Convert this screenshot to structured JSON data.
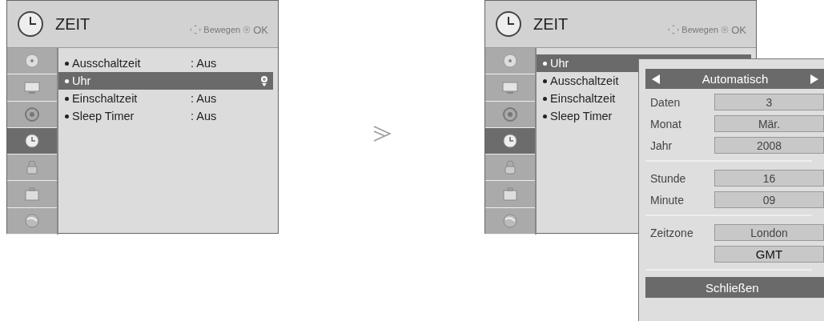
{
  "screens": [
    {
      "title": "ZEIT",
      "hint_move": "Bewegen",
      "hint_ok": "OK",
      "sidebar": [
        {
          "selected": false
        },
        {
          "selected": false
        },
        {
          "selected": false
        },
        {
          "selected": true
        },
        {
          "selected": false
        },
        {
          "selected": false
        },
        {
          "selected": false
        }
      ],
      "items": [
        {
          "label": "Ausschaltzeit",
          "value": ": Aus",
          "selected": false
        },
        {
          "label": "Uhr",
          "selected": true
        },
        {
          "label": "Einschaltzeit",
          "value": ": Aus",
          "selected": false
        },
        {
          "label": "Sleep Timer",
          "value": ": Aus",
          "selected": false
        }
      ]
    },
    {
      "title": "ZEIT",
      "hint_move": "Bewegen",
      "hint_ok": "OK",
      "sidebar": [
        {
          "selected": false
        },
        {
          "selected": false
        },
        {
          "selected": false
        },
        {
          "selected": true
        },
        {
          "selected": false
        },
        {
          "selected": false
        },
        {
          "selected": false
        }
      ],
      "items": [
        {
          "label": "Uhr",
          "selected": true
        },
        {
          "label": "Ausschaltzeit",
          "selected": false
        },
        {
          "label": "Einschaltzeit",
          "selected": false
        },
        {
          "label": "Sleep Timer",
          "selected": false
        }
      ],
      "popup": {
        "mode": "Automatisch",
        "groups": [
          [
            {
              "label": "Daten",
              "value": "3"
            },
            {
              "label": "Monat",
              "value": "Mär."
            },
            {
              "label": "Jahr",
              "value": "2008"
            }
          ],
          [
            {
              "label": "Stunde",
              "value": "16"
            },
            {
              "label": "Minute",
              "value": "09"
            }
          ],
          [
            {
              "label": "Zeitzone",
              "value": "London"
            },
            {
              "value": "GMT",
              "emphasis": true
            }
          ]
        ],
        "button": "Schließen"
      }
    }
  ]
}
